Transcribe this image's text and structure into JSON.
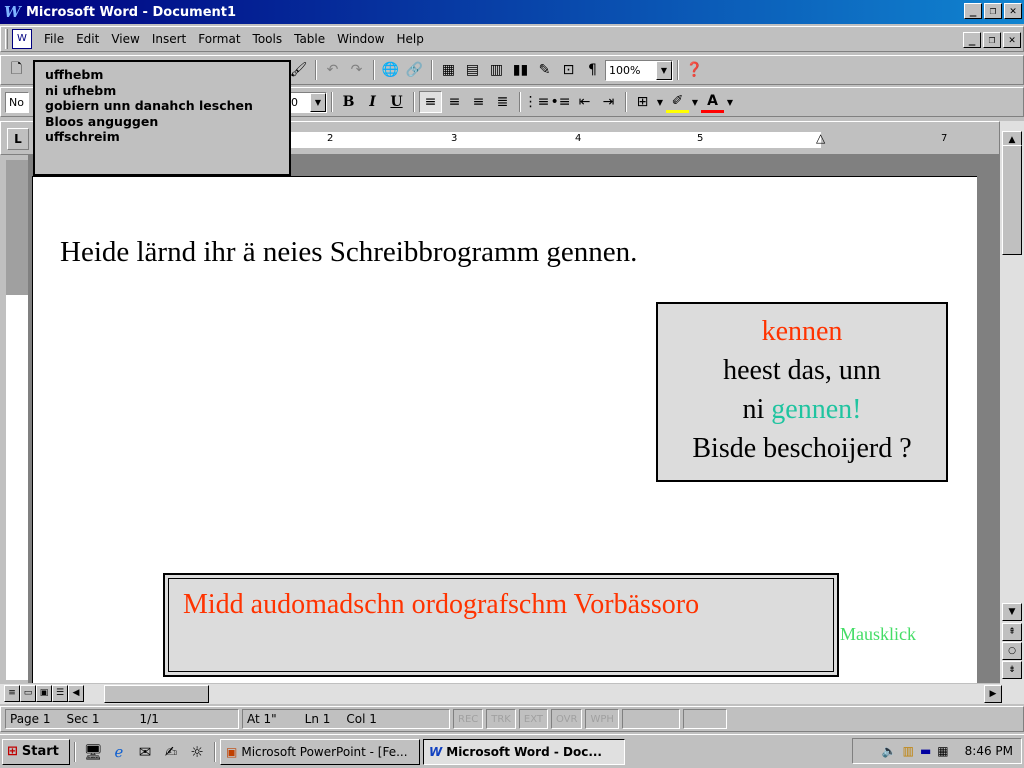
{
  "window": {
    "title": "Microsoft Word - Document1"
  },
  "menu": {
    "items": [
      "File",
      "Edit",
      "View",
      "Insert",
      "Format",
      "Tools",
      "Table",
      "Window",
      "Help"
    ]
  },
  "toolbar": {
    "zoom": "100%",
    "style_name": "No",
    "font_size": "0",
    "bold_label": "B",
    "italic_label": "I",
    "underline_label": "U"
  },
  "popup_menu": {
    "items": [
      "uffhebm",
      "ni ufhebm",
      "gobiern unn danahch leschen",
      "Bloos anguggen",
      "uffschreim"
    ]
  },
  "ruler": {
    "numbers": [
      "2",
      "3",
      "4",
      "5",
      "7"
    ]
  },
  "document": {
    "main_line": "Heide lärnd ihr ä neies Schreibbrogramm gennen.",
    "explain_box": {
      "line1": "kennen",
      "line2": "heest das, unn",
      "line3_prefix": "ni",
      "line3_word": "gennen!",
      "line4": "Bisde beschoijerd ?"
    },
    "bottom_box_text": "Midd audomadschn ordografschm Vorbässoro",
    "hint": "Mausklick"
  },
  "statusbar": {
    "page": "Page 1",
    "sec": "Sec 1",
    "pages": "1/1",
    "at": "At 1\"",
    "ln": "Ln 1",
    "col": "Col 1",
    "modes": [
      "REC",
      "TRK",
      "EXT",
      "OVR",
      "WPH"
    ]
  },
  "taskbar": {
    "start_label": "Start",
    "tasks": [
      "Microsoft PowerPoint - [Fe...",
      "Microsoft Word - Doc..."
    ],
    "clock": "8:46 PM"
  },
  "colors": {
    "accent_red": "#ff3300",
    "accent_teal": "#20c4a0",
    "hint_green": "#44dd66",
    "titlebar_start": "#000080"
  }
}
